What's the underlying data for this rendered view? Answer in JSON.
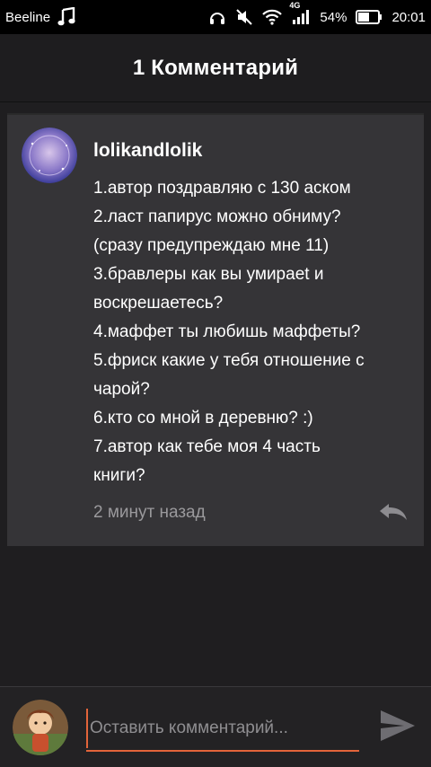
{
  "status_bar": {
    "carrier": "Beeline",
    "network": "4G",
    "battery": "54%",
    "time": "20:01",
    "icons": [
      "music-note-icon",
      "headphones-icon",
      "mute-icon",
      "wifi-icon",
      "signal-icon",
      "battery-icon"
    ]
  },
  "header": {
    "title": "1 Комментарий"
  },
  "comment": {
    "username": "lolikandlolik",
    "lines": [
      "1.автор поздравляю с 130 аском",
      "2.ласт папирус можно обниму?",
      "(сразу предупреждаю мне 11)",
      "3.бравлеры как вы умираеt и",
      "воскрешаетесь?",
      "4.маффет ты любишь маффеты?",
      "5.фриск какие у тебя отношение с",
      "чарой?",
      "6.кто со мной в деревню? :)",
      "7.автор как тебе моя 4 часть",
      "книги?"
    ],
    "time": "2 минут назад",
    "reply_icon": "reply-icon"
  },
  "composer": {
    "placeholder": "Оставить комментарий...",
    "value": "",
    "send_icon": "send-icon"
  },
  "colors": {
    "accent": "#e2643a",
    "card": "#353437",
    "background": "#1f1e20",
    "muted_text": "#9a999c"
  }
}
